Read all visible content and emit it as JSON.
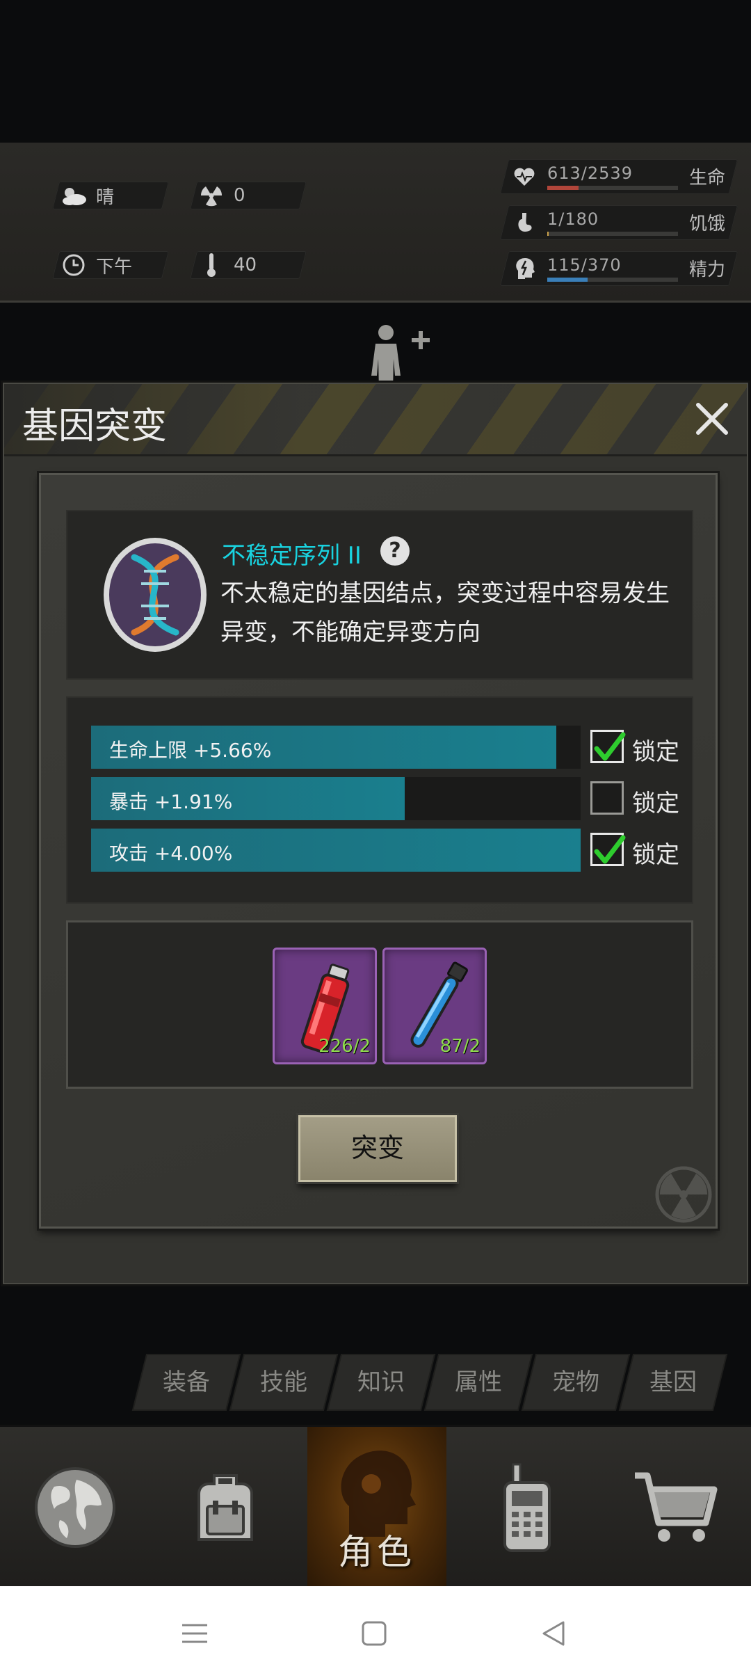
{
  "status": {
    "weather": "晴",
    "radiation": "0",
    "time_of_day": "下午",
    "temperature": "40",
    "vitals": [
      {
        "value": "613/2539",
        "label": "生命",
        "fraction": 0.24,
        "color": "#b0453a"
      },
      {
        "value": "1/180",
        "label": "饥饿",
        "fraction": 0.01,
        "color": "#c9a14a"
      },
      {
        "value": "115/370",
        "label": "精力",
        "fraction": 0.31,
        "color": "#3a7fb8"
      }
    ]
  },
  "dialog": {
    "title": "基因突变",
    "sequence_name": "不稳定序列 II",
    "description": "不太稳定的基因结点，突变过程中容易发生异变，不能确定异变方向",
    "stats": [
      {
        "text": "生命上限 +5.66%",
        "fill": 0.95,
        "locked": true,
        "lock_label": "锁定"
      },
      {
        "text": "暴击 +1.91%",
        "fill": 0.64,
        "locked": false,
        "lock_label": "锁定"
      },
      {
        "text": "攻击 +4.00%",
        "fill": 1.0,
        "locked": true,
        "lock_label": "锁定"
      }
    ],
    "items": [
      {
        "icon": "red-vial-icon",
        "count": "226/2"
      },
      {
        "icon": "blue-vial-icon",
        "count": "87/2"
      }
    ],
    "mutate_label": "突变"
  },
  "tabs": [
    {
      "label": "装备",
      "active": false
    },
    {
      "label": "技能",
      "active": false
    },
    {
      "label": "知识",
      "active": false
    },
    {
      "label": "属性",
      "active": false
    },
    {
      "label": "宠物",
      "active": false
    },
    {
      "label": "基因",
      "active": true
    }
  ],
  "nav": {
    "character_label": "角色"
  },
  "colors": {
    "accent_cyan": "#19d3e0",
    "bar_teal": "#1a7f8e",
    "item_purple": "#6a3b82",
    "check_green": "#2ecc2e"
  }
}
